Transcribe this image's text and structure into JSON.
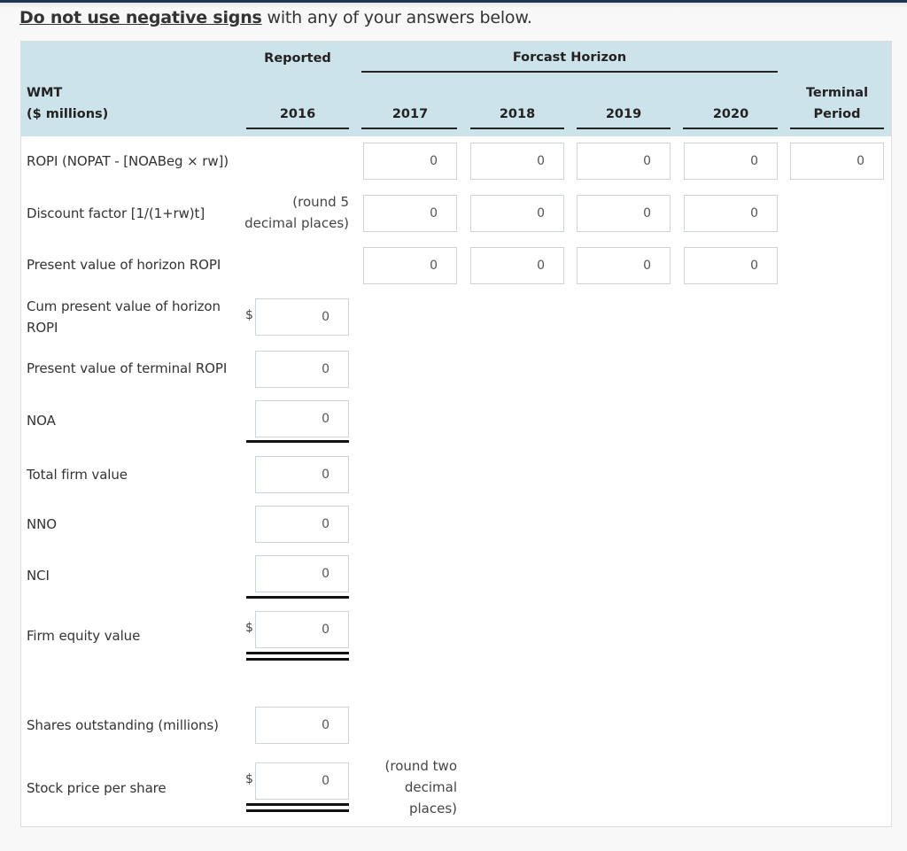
{
  "instruction": {
    "emphasis": "Do not use negative signs",
    "rest": " with any of your answers below."
  },
  "table": {
    "company": "WMT",
    "units": "($ millions)",
    "group_headers": {
      "reported": "Reported",
      "forecast": "Forcast Horizon"
    },
    "columns": {
      "c2016": "2016",
      "c2017": "2017",
      "c2018": "2018",
      "c2019": "2019",
      "c2020": "2020",
      "terminal_line1": "Terminal",
      "terminal_line2": "Period"
    },
    "rows": {
      "ropi": {
        "label": "ROPI (NOPAT - [NOABeg × rw])",
        "values": {
          "c2017": "0",
          "c2018": "0",
          "c2019": "0",
          "c2020": "0",
          "terminal": "0"
        }
      },
      "discount": {
        "label": "Discount factor [1/(1+rw)t]",
        "note_line1": "(round 5",
        "note_line2": "decimal places)",
        "values": {
          "c2017": "0",
          "c2018": "0",
          "c2019": "0",
          "c2020": "0"
        }
      },
      "pv_horizon": {
        "label": "Present value of horizon ROPI",
        "values": {
          "c2017": "0",
          "c2018": "0",
          "c2019": "0",
          "c2020": "0"
        }
      },
      "cum_pv": {
        "label_line1": "Cum present value of horizon",
        "label_line2": "ROPI",
        "currency": "$",
        "value": "0"
      },
      "pv_terminal": {
        "label": "Present value of terminal ROPI",
        "value": "0"
      },
      "noa": {
        "label": "NOA",
        "value": "0"
      },
      "total_firm": {
        "label": "Total firm value",
        "value": "0"
      },
      "nno": {
        "label": "NNO",
        "value": "0"
      },
      "nci": {
        "label": "NCI",
        "value": "0"
      },
      "equity": {
        "label": "Firm equity value",
        "currency": "$",
        "value": "0"
      },
      "shares": {
        "label": "Shares outstanding (millions)",
        "value": "0"
      },
      "price": {
        "label": "Stock price per share",
        "currency": "$",
        "value": "0",
        "note_line1": "(round two",
        "note_line2": "decimal",
        "note_line3": "places)"
      }
    }
  }
}
